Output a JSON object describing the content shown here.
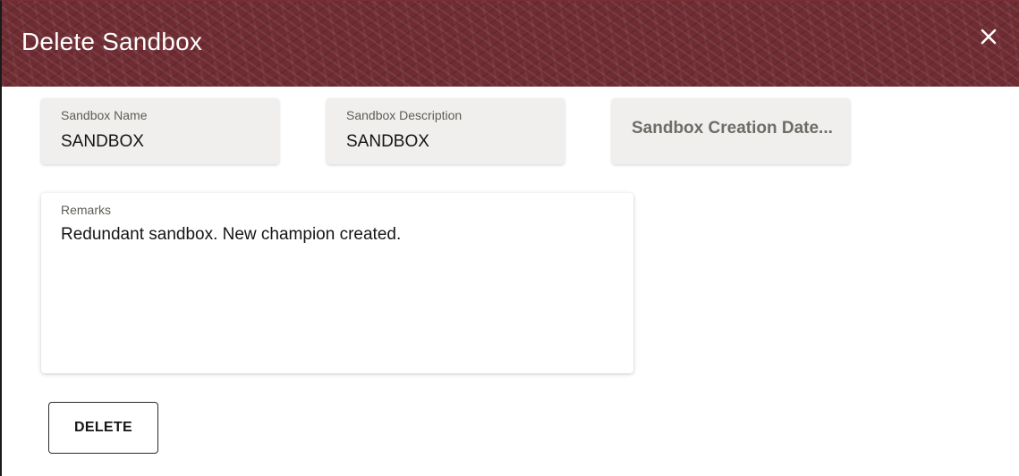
{
  "dialog": {
    "title": "Delete Sandbox",
    "close_icon": "close-icon"
  },
  "fields": {
    "sandbox_name": {
      "label": "Sandbox Name",
      "value": "SANDBOX"
    },
    "sandbox_description": {
      "label": "Sandbox Description",
      "value": "SANDBOX"
    },
    "sandbox_creation_date": {
      "placeholder": "Sandbox Creation Date..."
    }
  },
  "remarks": {
    "label": "Remarks",
    "value": "Redundant sandbox. New champion created."
  },
  "actions": {
    "delete_label": "DELETE"
  },
  "colors": {
    "header": "#6f2d33",
    "field_background": "#f1efed"
  }
}
